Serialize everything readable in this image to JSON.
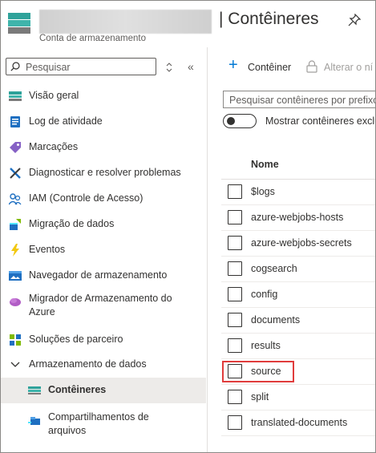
{
  "header": {
    "title": "| Contêineres",
    "subtitle": "Conta de armazenamento"
  },
  "sidebar": {
    "search_placeholder": "Pesquisar",
    "collapse_glyph": "«",
    "items": [
      {
        "label": "Visão geral",
        "icon": "overview-icon"
      },
      {
        "label": "Log de atividade",
        "icon": "activity-log-icon"
      },
      {
        "label": "Marcações",
        "icon": "tags-icon"
      },
      {
        "label": "Diagnosticar e resolver problemas",
        "icon": "diagnose-icon"
      },
      {
        "label": "IAM (Controle de Acesso)",
        "icon": "iam-icon"
      },
      {
        "label": "Migração de dados",
        "icon": "data-migration-icon"
      },
      {
        "label": "Eventos",
        "icon": "events-icon"
      },
      {
        "label": "Navegador de armazenamento",
        "icon": "storage-browser-icon"
      },
      {
        "label": "Migrador de Armazenamento do Azure",
        "icon": "storage-mover-icon"
      },
      {
        "label": "Soluções de parceiro",
        "icon": "partner-solutions-icon"
      },
      {
        "label": "Armazenamento de dados",
        "icon": "chevron-down-icon"
      },
      {
        "label": "Contêineres",
        "icon": "containers-icon",
        "selected": true
      },
      {
        "label": "Compartilhamentos de arquivos",
        "icon": "file-shares-icon"
      }
    ]
  },
  "toolbar": {
    "add_label": "Contêiner",
    "add_glyph": "+",
    "access_label": "Alterar o ní"
  },
  "filter": {
    "placeholder": "Pesquisar contêineres por prefixo"
  },
  "toggle": {
    "label": "Mostrar contêineres excluídos",
    "on": false
  },
  "table": {
    "column_header": "Nome",
    "rows": [
      "$logs",
      "azure-webjobs-hosts",
      "azure-webjobs-secrets",
      "cogsearch",
      "config",
      "documents",
      "results",
      "source",
      "split",
      "translated-documents"
    ],
    "highlighted_row": "source"
  },
  "colors": {
    "accent": "#0078d4",
    "highlight": "#e03c3c",
    "selected_bg": "#edebe9"
  }
}
